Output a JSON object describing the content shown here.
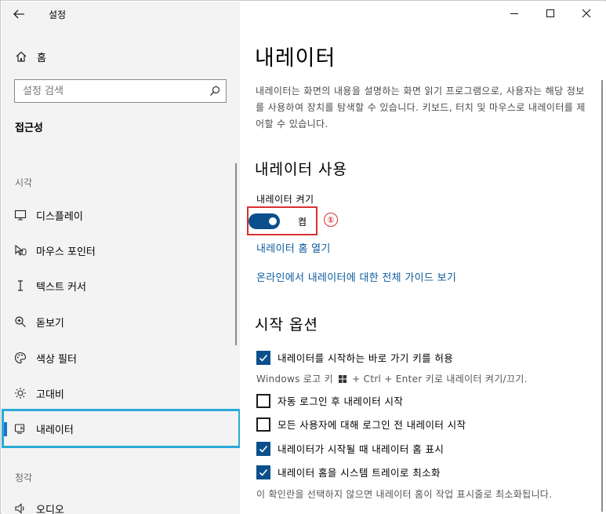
{
  "app": {
    "title": "설정"
  },
  "sidebar": {
    "home_label": "홈",
    "search_placeholder": "설정 검색",
    "section_title": "접근성",
    "group_vision": "시각",
    "group_hearing": "청각",
    "items": [
      {
        "label": "디스플레이",
        "icon": "monitor-icon"
      },
      {
        "label": "마우스 포인터",
        "icon": "mouse-pointer-icon"
      },
      {
        "label": "텍스트 커서",
        "icon": "text-cursor-icon"
      },
      {
        "label": "돋보기",
        "icon": "magnifier-icon"
      },
      {
        "label": "색상 필터",
        "icon": "palette-icon"
      },
      {
        "label": "고대비",
        "icon": "brightness-icon"
      },
      {
        "label": "내레이터",
        "icon": "narrator-icon",
        "selected": true
      },
      {
        "label": "오디오",
        "icon": "speaker-icon"
      }
    ]
  },
  "main": {
    "title": "내레이터",
    "description": "내레이터는 화면의 내용을 설명하는 화면 읽기 프로그램으로, 사용자는 해당 정보를 사용하여 장치를 탐색할 수 있습니다. 키보드, 터치 및 마우스로 내레이터를 제어할 수 있습니다.",
    "use_heading": "내레이터 사용",
    "toggle_label": "내레이터 켜기",
    "toggle_state": "켬",
    "toggle_on": true,
    "callout_number": "①",
    "link_home": "내레이터 홈 열기",
    "link_guide": "온라인에서 내레이터에 대한 전체 가이드 보기",
    "start_heading": "시작 옵션",
    "options": [
      {
        "label": "내레이터를 시작하는 바로 가기 키를 허용",
        "checked": true
      },
      {
        "label": "자동 로그인 후 내레이터 시작",
        "checked": false
      },
      {
        "label": "모든 사용자에 대해 로그인 전 내레이터 시작",
        "checked": false
      },
      {
        "label": "내레이터가 시작될 때 내레이터 홈 표시",
        "checked": true
      },
      {
        "label": "내레이터 홈을 시스템 트레이로 최소화",
        "checked": true
      }
    ],
    "shortcut_hint_prefix": "Windows 로고 키",
    "shortcut_hint_suffix": "+ Ctrl + Enter 키로 내레이터 켜기/끄기.",
    "tray_hint": "이 확인란을 선택하지 않으면 내레이터 홈이 작업 표시줄로 최소화됩니다."
  },
  "colors": {
    "accent": "#0b4f8c",
    "link": "#0a5a9c",
    "highlight": "#d93030",
    "selection_box": "#2aa9d8"
  }
}
